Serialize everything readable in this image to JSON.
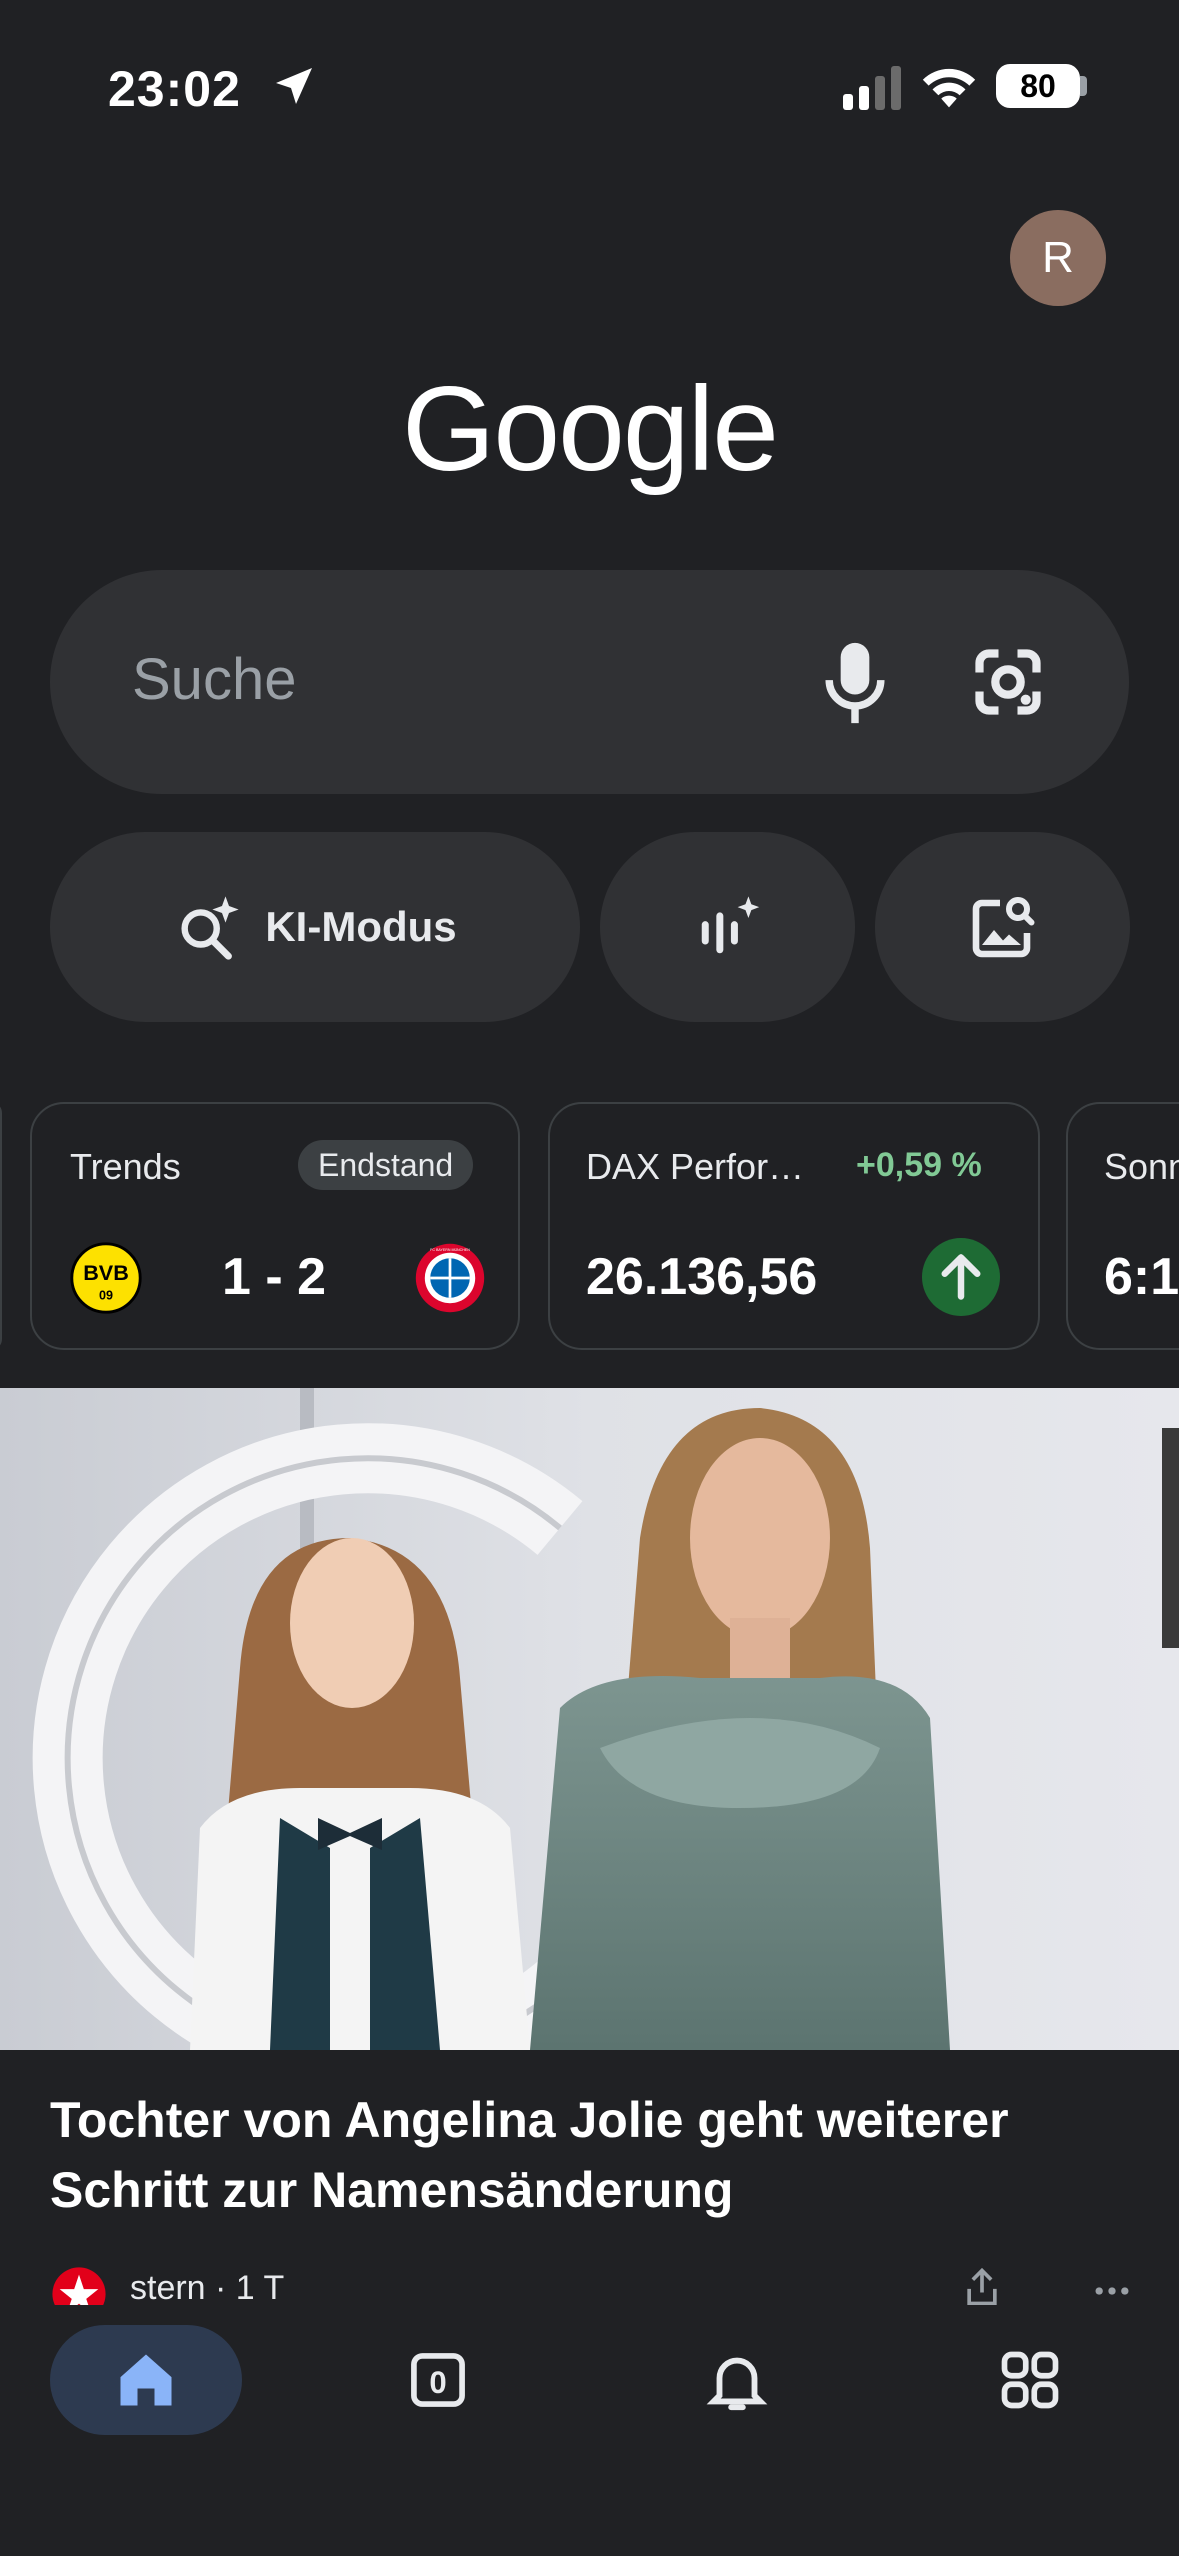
{
  "status": {
    "time": "23:02",
    "battery": "80"
  },
  "account": {
    "avatar_letter": "R"
  },
  "logo": "Google",
  "search": {
    "placeholder": "Suche"
  },
  "actions": {
    "ai_mode_label": "KI-Modus"
  },
  "cards": {
    "trends": {
      "title": "Trends",
      "badge": "Endstand",
      "score": "1 - 2",
      "home_team": "BVB",
      "home_team_sub": "09",
      "away_team": "FC BAYERN MÜNCHEN"
    },
    "dax": {
      "title": "DAX Perfor…",
      "change": "+0,59 %",
      "value": "26.136,56"
    },
    "sun": {
      "title": "Sonn",
      "value": "6:1"
    }
  },
  "feed": {
    "headline": "Tochter von Angelina Jolie geht weiterer Schritt zur Namensänderung",
    "source": "stern · 1 T"
  },
  "nav": {
    "tabs_count": "0"
  },
  "colors": {
    "background": "#202124",
    "surface": "#303134",
    "positive": "#81c995",
    "home_active": "#8ab4f8"
  }
}
